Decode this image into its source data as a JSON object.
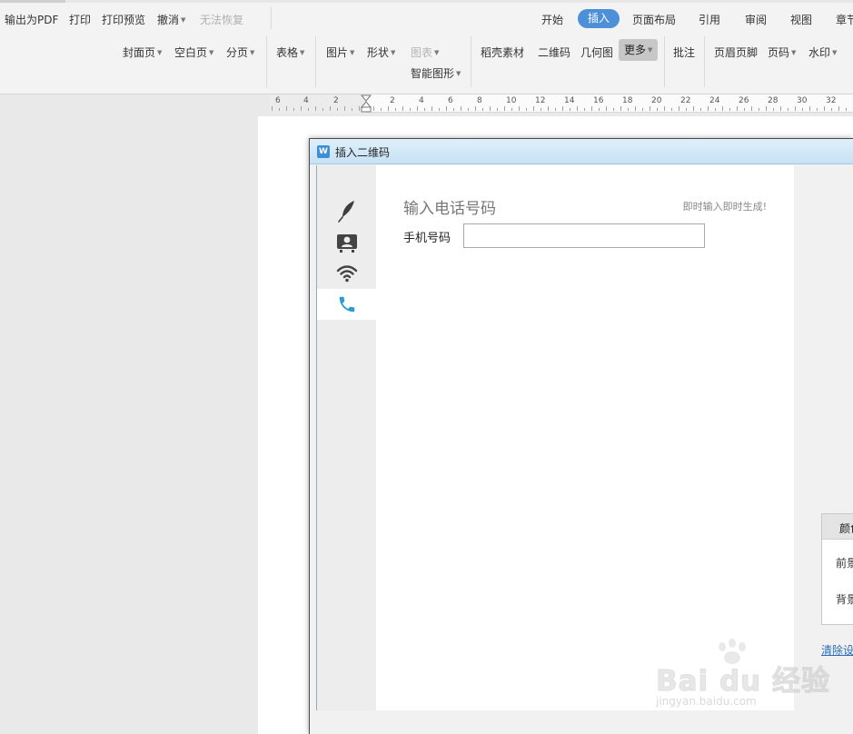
{
  "quick_actions": {
    "export_pdf": "输出为PDF",
    "print": "打印",
    "print_preview": "打印预览",
    "undo": "撤消",
    "redo": "无法恢复"
  },
  "menu_tabs": [
    {
      "label": "开始"
    },
    {
      "label": "插入",
      "active": true
    },
    {
      "label": "页面布局"
    },
    {
      "label": "引用"
    },
    {
      "label": "审阅"
    },
    {
      "label": "视图"
    },
    {
      "label": "章节"
    }
  ],
  "ribbon": {
    "cover_page": "封面页",
    "blank_page": "空白页",
    "page_break": "分页",
    "table": "表格",
    "picture": "图片",
    "shape": "形状",
    "chart": "图表",
    "smart_art": "智能图形",
    "docer_material": "稻壳素材",
    "qr_code": "二维码",
    "geometry": "几何图",
    "more": "更多",
    "comment": "批注",
    "header_footer": "页眉页脚",
    "page_number": "页码",
    "watermark": "水印"
  },
  "ruler": {
    "labels": [
      "6",
      "4",
      "2",
      "2",
      "4",
      "6",
      "8",
      "10",
      "12",
      "14",
      "16",
      "18",
      "20",
      "22",
      "24",
      "26",
      "28",
      "30",
      "32"
    ]
  },
  "dialog": {
    "title": "插入二维码",
    "app_icon_letter": "W",
    "nav": [
      {
        "icon": "feather-icon",
        "active": false
      },
      {
        "icon": "contact-card-icon",
        "active": false
      },
      {
        "icon": "wifi-icon",
        "active": false
      },
      {
        "icon": "phone-icon",
        "active": true
      }
    ],
    "panel_title": "输入电话号码",
    "hint": "即时输入即时生成!",
    "phone_label": "手机号码",
    "phone_value": "",
    "color_tab": "颜色",
    "foreground": "前景",
    "background": "背景",
    "clear_link": "清除设"
  },
  "watermark": {
    "main": "Bai du 经验",
    "sub": "jingyan.baidu.com"
  },
  "colors": {
    "accent": "#4d8fd9",
    "phone_icon": "#2f9ad8",
    "link": "#2b6db8"
  }
}
